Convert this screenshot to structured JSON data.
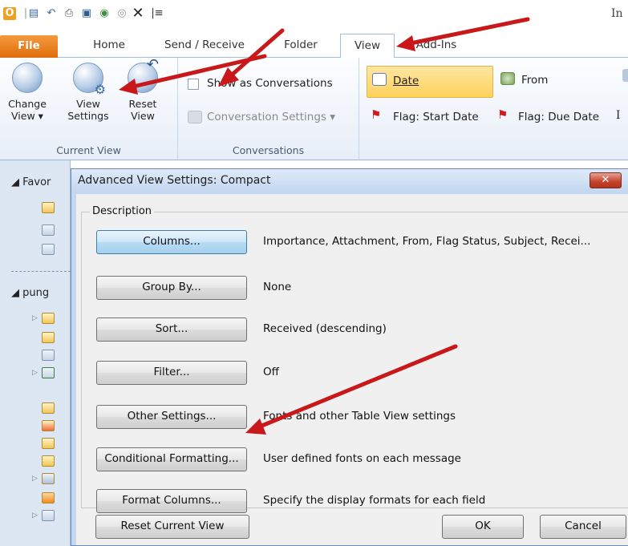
{
  "quick_access": {
    "title_partial": "In",
    "customize_glyph": "|≡",
    "icons": [
      "outlook-icon",
      "separator-icon",
      "new-folder-icon",
      "undo-icon",
      "print-icon",
      "quick-print-icon",
      "green-circle-icon",
      "gray-circle-icon",
      "delete-x-icon"
    ]
  },
  "tabs": [
    {
      "label": "File"
    },
    {
      "label": "Home"
    },
    {
      "label": "Send / Receive"
    },
    {
      "label": "Folder"
    },
    {
      "label": "View"
    },
    {
      "label": "Add-Ins"
    }
  ],
  "ribbon": {
    "current_view": {
      "label": "Current View",
      "change_view": {
        "line1": "Change",
        "line2": "View ▾"
      },
      "view_settings": {
        "line1": "View",
        "line2": "Settings"
      },
      "reset_view": {
        "line1": "Reset",
        "line2": "View"
      }
    },
    "conversations": {
      "label": "Conversations",
      "show_as": "Show as Conversations",
      "settings": "Conversation Settings ▾"
    },
    "arrangement": {
      "date": "Date",
      "from": "From",
      "flag_start": "Flag: Start Date",
      "flag_due": "Flag: Due Date",
      "partial": "I"
    }
  },
  "navpane": {
    "favorites": "◢ Favor",
    "mailbox": "◢ pung"
  },
  "dialog": {
    "title": "Advanced View Settings: Compact",
    "close_glyph": "✕",
    "legend": "Description",
    "rows": [
      {
        "button": "Columns...",
        "desc": "Importance, Attachment, From, Flag Status, Subject, Recei..."
      },
      {
        "button": "Group By...",
        "desc": "None"
      },
      {
        "button": "Sort...",
        "desc": "Received (descending)"
      },
      {
        "button": "Filter...",
        "desc": "Off"
      },
      {
        "button": "Other Settings...",
        "desc": "Fonts and other Table View settings"
      },
      {
        "button": "Conditional Formatting...",
        "desc": "User defined fonts on each message"
      },
      {
        "button": "Format Columns...",
        "desc": "Specify the display formats for each field"
      }
    ],
    "reset_button": "Reset Current View",
    "ok_button": "OK",
    "cancel_button": "Cancel"
  },
  "colors": {
    "file_tab": "#e06d0c",
    "ribbon_bg": "#e7eef8",
    "dialog_frame": "#c4d7ee",
    "arrow_red": "#c8181a"
  }
}
